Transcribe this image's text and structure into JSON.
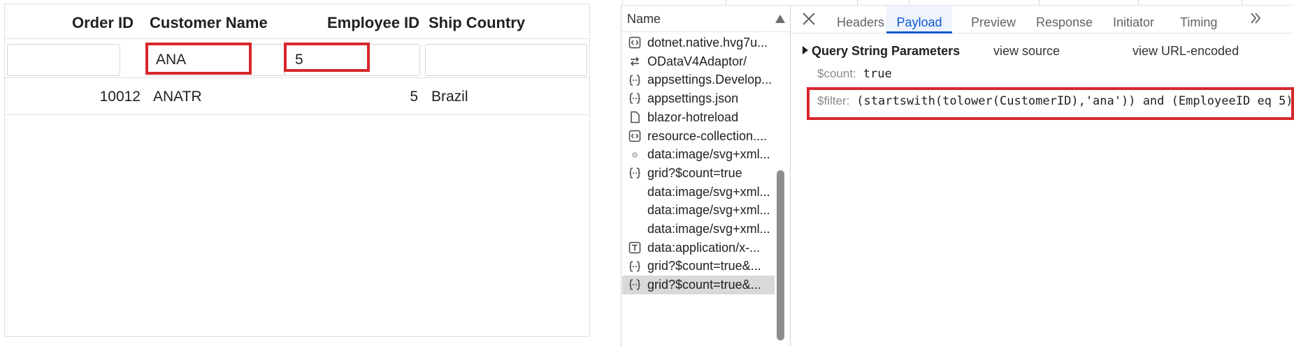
{
  "grid": {
    "columns": [
      "Order ID",
      "Customer Name",
      "Employee ID",
      "Ship Country"
    ],
    "filters": {
      "order_id": "",
      "customer_name": "ANA",
      "employee_id": "5",
      "ship_country": ""
    },
    "rows": [
      {
        "order_id": "10012",
        "customer_name": "ANATR",
        "employee_id": "5",
        "ship_country": "Brazil"
      }
    ],
    "highlight_color": "#d7262b"
  },
  "devtools": {
    "name_header": "Name",
    "requests": [
      {
        "icon": "code-icon",
        "label": "dotnet.native.hvg7u..."
      },
      {
        "icon": "arrows-icon",
        "label": "ODataV4Adaptor/"
      },
      {
        "icon": "braces-icon",
        "label": "appsettings.Develop..."
      },
      {
        "icon": "braces-icon",
        "label": "appsettings.json"
      },
      {
        "icon": "document-icon",
        "label": "blazor-hotreload"
      },
      {
        "icon": "code-icon",
        "label": "resource-collection...."
      },
      {
        "icon": "dot-icon",
        "label": "data:image/svg+xml..."
      },
      {
        "icon": "braces-icon",
        "label": "grid?$count=true"
      },
      {
        "icon": "",
        "label": "data:image/svg+xml..."
      },
      {
        "icon": "",
        "label": "data:image/svg+xml..."
      },
      {
        "icon": "",
        "label": "data:image/svg+xml..."
      },
      {
        "icon": "text-icon",
        "label": "data:application/x-..."
      },
      {
        "icon": "braces-icon",
        "label": "grid?$count=true&..."
      },
      {
        "icon": "braces-icon",
        "label": "grid?$count=true&...",
        "selected": true
      }
    ],
    "tabs": [
      "Headers",
      "Payload",
      "Preview",
      "Response",
      "Initiator",
      "Timing"
    ],
    "active_tab": "Payload",
    "section": {
      "title": "Query String Parameters",
      "view_source": "view source",
      "view_url_encoded": "view URL-encoded"
    },
    "params": [
      {
        "key": "$count:",
        "value": "true"
      },
      {
        "key": "$filter:",
        "value": "(startswith(tolower(CustomerID),'ana')) and (EmployeeID eq 5)"
      }
    ],
    "accent_color": "#0b57d0"
  }
}
